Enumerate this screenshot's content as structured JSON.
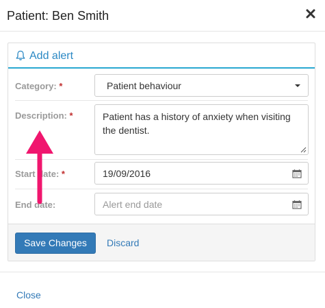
{
  "modal": {
    "title": "Patient: Ben Smith",
    "close_icon": "close-x-icon"
  },
  "panel": {
    "icon": "bell-icon",
    "title": "Add alert",
    "accent_color": "#29a8d1"
  },
  "form": {
    "category": {
      "label": "Category:",
      "required_mark": "*",
      "value": "Patient behaviour"
    },
    "description": {
      "label": "Description:",
      "required_mark": "*",
      "value": "Patient has a history of anxiety when visiting the dentist."
    },
    "start_date": {
      "label": "Start date:",
      "required_mark": "*",
      "value": "19/09/2016",
      "icon": "calendar-icon"
    },
    "end_date": {
      "label": "End date:",
      "placeholder": "Alert end date",
      "icon": "calendar-icon"
    }
  },
  "footer": {
    "save_label": "Save Changes",
    "discard_label": "Discard"
  },
  "bottom": {
    "close_label": "Close"
  },
  "annotation": {
    "arrow_color": "#f0166e"
  }
}
